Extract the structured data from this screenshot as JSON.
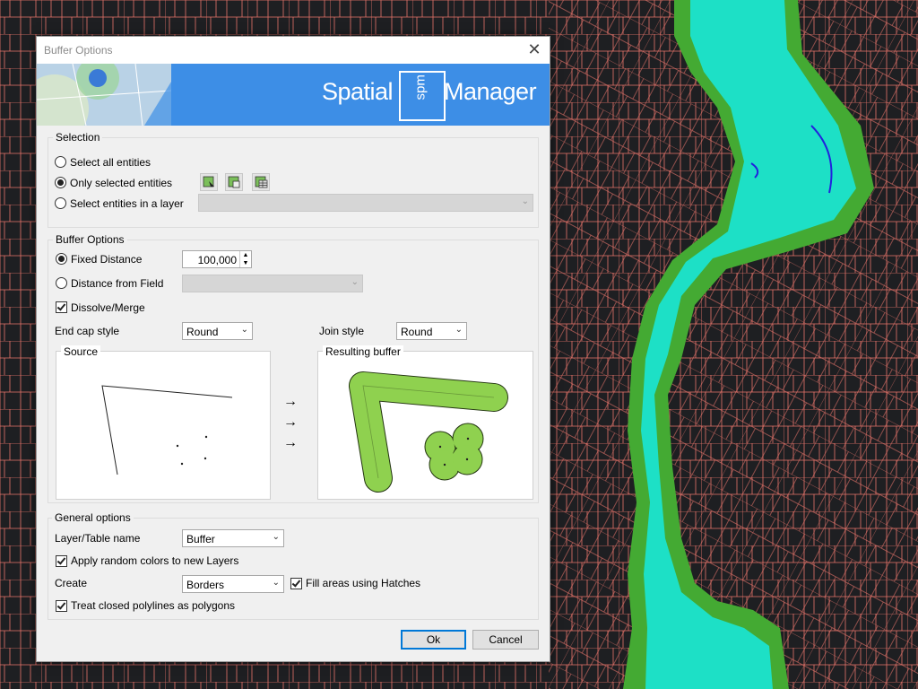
{
  "dialog": {
    "title": "Buffer Options",
    "close_glyph": "✕",
    "banner": {
      "brand_left": "Spatial",
      "brand_mark": "spm",
      "brand_right": "Manager"
    }
  },
  "selection": {
    "title": "Selection",
    "options": [
      {
        "label": "Select all entities",
        "selected": false
      },
      {
        "label": "Only selected entities",
        "selected": true
      },
      {
        "label": "Select entities in a layer",
        "selected": false
      }
    ],
    "tool_icons": [
      "select-pick-icon",
      "select-layer-icon",
      "select-table-icon"
    ],
    "layer_combo_value": ""
  },
  "buffer": {
    "title": "Buffer Options",
    "fixed_distance_label": "Fixed Distance",
    "fixed_distance_selected": true,
    "fixed_distance_value": "100,000",
    "distance_field_label": "Distance from Field",
    "distance_field_selected": false,
    "distance_field_value": "",
    "dissolve_label": "Dissolve/Merge",
    "dissolve_checked": true,
    "endcap_label": "End cap style",
    "endcap_value": "Round",
    "join_label": "Join style",
    "join_value": "Round",
    "source_label": "Source",
    "result_label": "Resulting buffer",
    "arrows": [
      "→",
      "→",
      "→"
    ]
  },
  "general": {
    "title": "General options",
    "layer_name_label": "Layer/Table name",
    "layer_name_value": "Buffer",
    "random_colors_label": "Apply random colors to new Layers",
    "random_colors_checked": true,
    "create_label": "Create",
    "create_value": "Borders",
    "hatches_label": "Fill areas using Hatches",
    "hatches_checked": true,
    "closed_polylines_label": "Treat closed polylines as polygons",
    "closed_polylines_checked": true
  },
  "buttons": {
    "ok": "Ok",
    "cancel": "Cancel"
  },
  "colors": {
    "map_background": "#1e1f22",
    "parcel_lines": "#e8746a",
    "river_fill": "#1de0c6",
    "buffer_green": "#44aa33",
    "banner_blue": "#3d8ee6",
    "buffer_preview_fill": "#8fd14f"
  }
}
